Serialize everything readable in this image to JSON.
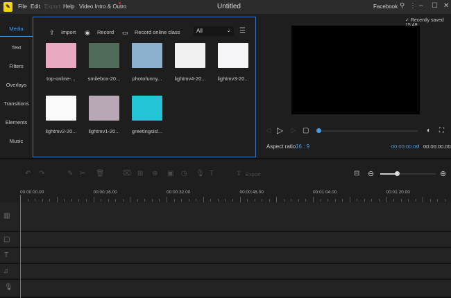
{
  "titlebar": {
    "menu": [
      "File",
      "Edit",
      "Export",
      "Help",
      "Video Intro & Outro"
    ],
    "title": "Untitled",
    "account": "Facebook"
  },
  "sidebar": {
    "items": [
      "Media",
      "Text",
      "Filters",
      "Overlays",
      "Transitions",
      "Elements",
      "Music"
    ]
  },
  "media": {
    "import": "Import",
    "record": "Record",
    "record_online": "Record online class",
    "filter": "All",
    "items": [
      {
        "name": "top-online-...",
        "color": "#e9a9c3"
      },
      {
        "name": "smilebox-20...",
        "color": "#4f6b5a"
      },
      {
        "name": "photofunny...",
        "color": "#8db0cf"
      },
      {
        "name": "lightmv4-20...",
        "color": "#f0f0f0"
      },
      {
        "name": "lightmv3-20...",
        "color": "#f5f5f8"
      },
      {
        "name": "lightmv2-20...",
        "color": "#fafafa"
      },
      {
        "name": "lightmv1-20...",
        "color": "#b8a8b5"
      },
      {
        "name": "greetingsisl...",
        "color": "#23c4d6"
      }
    ]
  },
  "preview": {
    "saved": "Recently saved 15:48",
    "aspect_label": "Aspect ratio",
    "aspect_value": "16 : 9",
    "current_time": "00:00:00.00",
    "separator": "/",
    "total_time": "00:00:00.00",
    "progress": 0,
    "accent": "#4a9be0"
  },
  "toolbar": {
    "export": "Export",
    "zoom_level": 0.3
  },
  "ruler": [
    "00:00:00.00",
    "00:00:16.00",
    "00:00:32.00",
    "00:00:48.00",
    "00:01:04.00",
    "00:01:20.00"
  ]
}
